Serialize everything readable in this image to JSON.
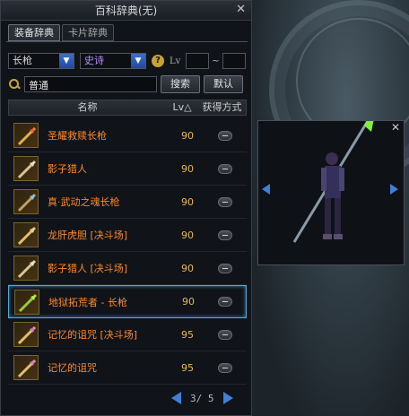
{
  "window": {
    "title": "百科辞典(无)",
    "close_icon": "close-icon"
  },
  "tabs": [
    {
      "label": "装备辞典",
      "active": true
    },
    {
      "label": "卡片辞典",
      "active": false
    }
  ],
  "filters": {
    "type_value": "长枪",
    "rarity_value": "史诗",
    "help_glyph": "?",
    "lv_label": "Lv",
    "lv_separator": "~"
  },
  "search": {
    "value": "普通",
    "button": "搜索",
    "default_button": "默认"
  },
  "table": {
    "headers": {
      "name": "名称",
      "lv": "Lv△",
      "source": "获得方式"
    },
    "rows": [
      {
        "name": "圣耀救赎长枪",
        "lv": "90"
      },
      {
        "name": "影子猎人",
        "lv": "90"
      },
      {
        "name": "真·武动之魂长枪",
        "lv": "90"
      },
      {
        "name": "龙肝虎胆 [决斗场]",
        "lv": "90"
      },
      {
        "name": "影子猎人 [决斗场]",
        "lv": "90"
      },
      {
        "name": "地狱拓荒者 - 长枪",
        "lv": "90"
      },
      {
        "name": "记忆的诅咒 [决斗场]",
        "lv": "95"
      },
      {
        "name": "记忆的诅咒",
        "lv": "95"
      }
    ]
  },
  "pager": {
    "text": "3/ 5"
  },
  "colors": {
    "item_name": "#ff8a2a",
    "lv": "#e8b854",
    "accent": "#3f7fd8",
    "selected_border": "#5aa8d8"
  }
}
